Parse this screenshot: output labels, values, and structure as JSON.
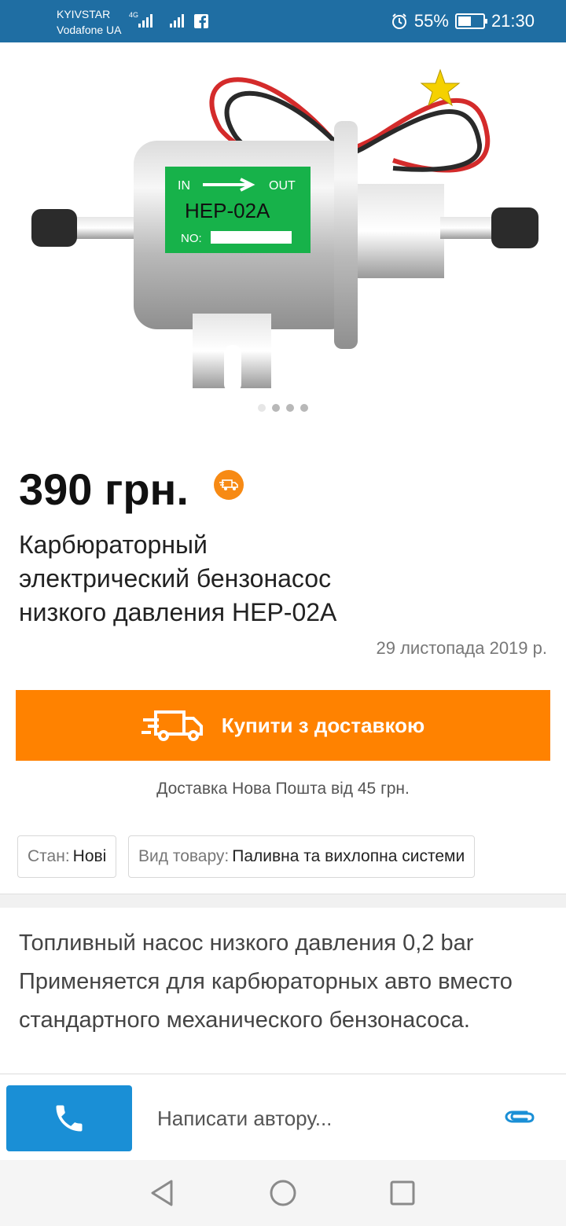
{
  "status_bar": {
    "carrier_1": "KYIVSTAR",
    "carrier_2": "Vodafone UA",
    "network": "4G",
    "battery": "55%",
    "battery_level": 0.55,
    "time": "21:30",
    "icons": [
      "signal-icon",
      "facebook-icon",
      "alarm-icon",
      "battery-icon"
    ]
  },
  "product": {
    "image_label_in": "IN",
    "image_label_out": "OUT",
    "image_model": "HEP-02A",
    "image_no": "NO:",
    "carousel_dots": 4,
    "carousel_active": 0,
    "price": "390 грн.",
    "title": "Карбюраторный электрический бензонасос низкого давления HEP-02A",
    "date": "29 листопада 2019 р."
  },
  "actions": {
    "buy_label": "Купити з доставкою",
    "delivery_note": "Доставка Нова Пошта від 45 грн."
  },
  "attributes": [
    {
      "key": "Стан:",
      "value": "Нові"
    },
    {
      "key": "Вид товару:",
      "value": "Паливна та вихлопна системи"
    }
  ],
  "description": "Топливный насос  низкого давления 0,2 bar Применяется для карбюраторных авто вместо стандартного механического бензонасоса.",
  "message_bar": {
    "placeholder": "Написати автору..."
  },
  "colors": {
    "accent": "#ff8200",
    "status_bar": "#1f6ea3",
    "call_button": "#1a8fd6"
  }
}
